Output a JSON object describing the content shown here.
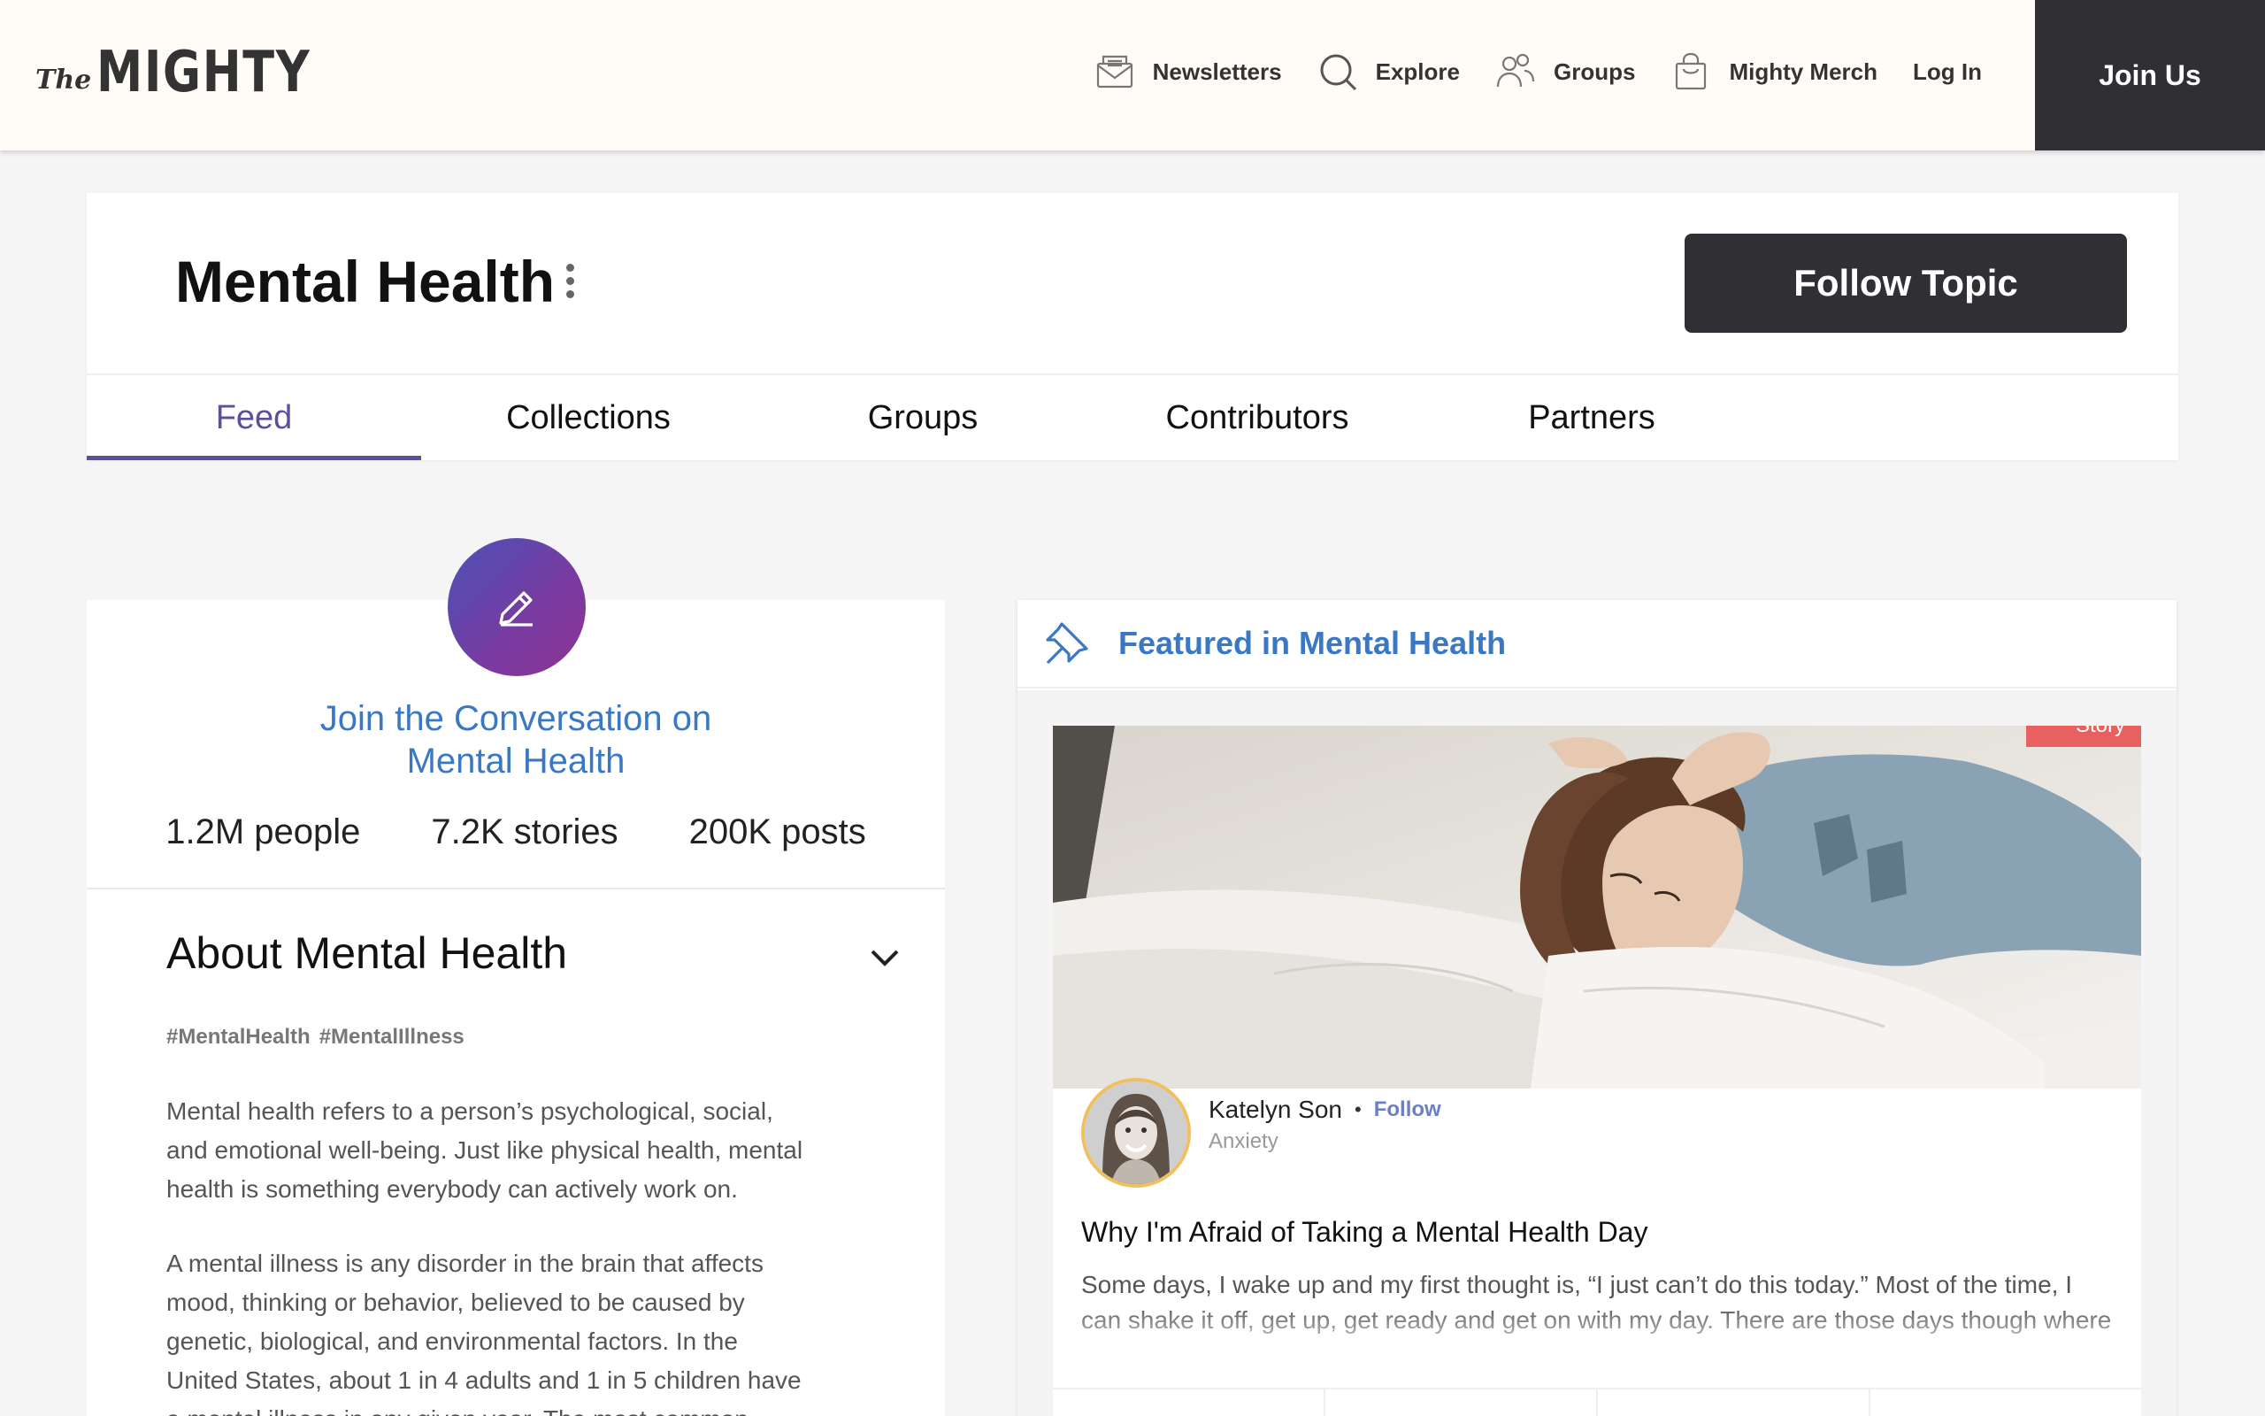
{
  "header": {
    "logo_the": "The",
    "logo_mighty": "MIGHTY",
    "nav": [
      {
        "label": "Newsletters",
        "icon": "newsletter-icon"
      },
      {
        "label": "Explore",
        "icon": "search-icon"
      },
      {
        "label": "Groups",
        "icon": "groups-icon"
      },
      {
        "label": "Mighty Merch",
        "icon": "shopping-bag-icon"
      },
      {
        "label": "Log In"
      }
    ],
    "join_label": "Join Us"
  },
  "topic": {
    "title": "Mental Health",
    "follow_label": "Follow Topic",
    "tabs": [
      "Feed",
      "Collections",
      "Groups",
      "Contributors",
      "Partners"
    ],
    "active_tab": "Feed"
  },
  "sidebar": {
    "join_line1": "Join the Conversation on",
    "join_line2": "Mental Health",
    "stats": [
      "1.2M people",
      "7.2K stories",
      "200K posts"
    ],
    "about_title": "About Mental Health",
    "hashtags": [
      "#MentalHealth",
      "#MentalIllness"
    ],
    "about_paragraphs": [
      "Mental health refers to a person’s psychological, social, and emotional well-being. Just like physical health, mental health is something everybody can actively work on.",
      "A mental illness is any disorder in the brain that affects mood, thinking or behavior, believed to be caused by genetic, biological, and environmental factors. In the United States, about 1 in 4 adults and 1 in 5 children have a mental illness in any given year. The most common"
    ]
  },
  "featured": {
    "title": "Featured in Mental Health",
    "badge": "Story",
    "author": "Katelyn Son",
    "follow_label": "Follow",
    "author_topic": "Anxiety",
    "story_title": "Why I'm Afraid of Taking a Mental Health Day",
    "excerpt": "Some days, I wake up and my first thought is, “I just can’t do this today.” Most of the time, I can shake it off, get up, get ready and get on with my day. There are those days though where I"
  },
  "colors": {
    "accent_purple": "#5b4f9e",
    "link_blue": "#3a78c3",
    "dark_button": "#2f2f34",
    "badge_red": "#e86060"
  }
}
